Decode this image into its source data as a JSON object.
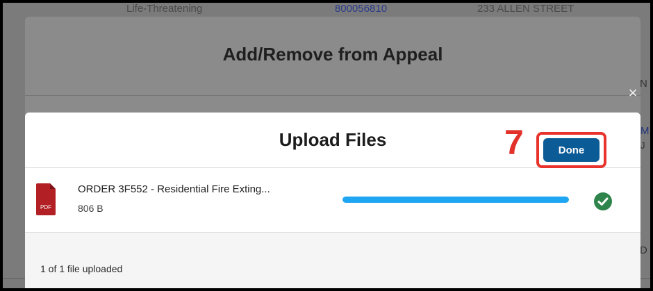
{
  "background": {
    "row_top": {
      "priority": "Life-Threatening",
      "id_link": "800056810",
      "address": "233 ALLEN STREET"
    },
    "right_fragments": {
      "n": "N",
      "m": "M",
      "j": "J",
      "d": "D"
    }
  },
  "parent_modal": {
    "title": "Add/Remove from Appeal",
    "close_glyph": "×"
  },
  "upload_modal": {
    "title": "Upload Files",
    "file": {
      "icon": "pdf-icon",
      "icon_label": "PDF",
      "name": "ORDER 3F552 - Residential Fire Exting...",
      "size": "806 B",
      "progress_fraction": 1.0,
      "status_icon": "check-circle-icon"
    },
    "footer": {
      "status": "1 of 1 file uploaded",
      "done_label": "Done"
    }
  },
  "annotation": {
    "step": "7",
    "color": "#e1312a"
  },
  "colors": {
    "progress": "#1fa6f2",
    "done_button": "#0b5b97",
    "success": "#2e844a"
  }
}
